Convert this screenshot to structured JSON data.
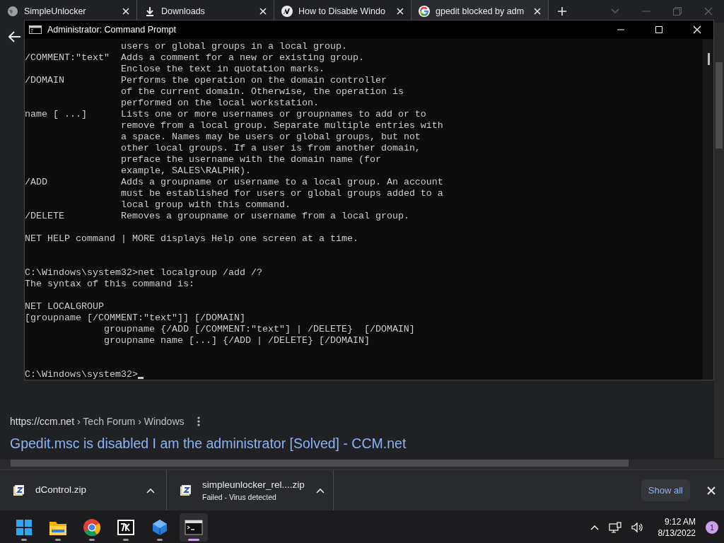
{
  "browser": {
    "tabs": [
      {
        "title": "SimpleUnlocker",
        "selected": false
      },
      {
        "title": "Downloads",
        "selected": false
      },
      {
        "title": "How to Disable Windo",
        "selected": false
      },
      {
        "title": "gpedit blocked by adm",
        "selected": true
      }
    ],
    "result": {
      "site": "https://ccm.net",
      "path": "› Tech Forum › Windows",
      "title": "Gpedit.msc is disabled I am the administrator [Solved] - CCM.net"
    },
    "downloads": [
      {
        "name": "dControl.zip"
      },
      {
        "name": "simpleunlocker_rel....zip",
        "status": "Failed - Virus detected"
      }
    ],
    "show_all": "Show all"
  },
  "console": {
    "title": "Administrator: Command Prompt",
    "lines": [
      {
        "kind": "cont",
        "text": "users or global groups in a local group."
      },
      {
        "kind": "option",
        "option": "/COMMENT:\"text\"",
        "text": "Adds a comment for a new or existing group."
      },
      {
        "kind": "cont",
        "text": "Enclose the text in quotation marks."
      },
      {
        "kind": "option",
        "option": "/DOMAIN",
        "text": "Performs the operation on the domain controller"
      },
      {
        "kind": "cont",
        "text": "of the current domain. Otherwise, the operation is"
      },
      {
        "kind": "cont",
        "text": "performed on the local workstation."
      },
      {
        "kind": "option",
        "option": "name [ ...]",
        "text": "Lists one or more usernames or groupnames to add or to"
      },
      {
        "kind": "cont",
        "text": "remove from a local group. Separate multiple entries with"
      },
      {
        "kind": "cont",
        "text": "a space. Names may be users or global groups, but not"
      },
      {
        "kind": "cont",
        "text": "other local groups. If a user is from another domain,"
      },
      {
        "kind": "cont",
        "text": "preface the username with the domain name (for"
      },
      {
        "kind": "cont",
        "text": "example, SALES\\RALPHR)."
      },
      {
        "kind": "option",
        "option": "/ADD",
        "text": "Adds a groupname or username to a local group. An account"
      },
      {
        "kind": "cont",
        "text": "must be established for users or global groups added to a"
      },
      {
        "kind": "cont",
        "text": "local group with this command."
      },
      {
        "kind": "option",
        "option": "/DELETE",
        "text": "Removes a groupname or username from a local group."
      },
      {
        "kind": "blank"
      },
      {
        "kind": "plain",
        "text": "NET HELP command | MORE displays Help one screen at a time."
      },
      {
        "kind": "blank"
      },
      {
        "kind": "blank"
      },
      {
        "kind": "plain",
        "text": "C:\\Windows\\system32>net localgroup /add /?"
      },
      {
        "kind": "plain",
        "text": "The syntax of this command is:"
      },
      {
        "kind": "blank"
      },
      {
        "kind": "plain",
        "text": "NET LOCALGROUP"
      },
      {
        "kind": "plain",
        "text": "[groupname [/COMMENT:\"text\"]] [/DOMAIN]"
      },
      {
        "kind": "indent",
        "text": "groupname {/ADD [/COMMENT:\"text\"] | /DELETE}  [/DOMAIN]"
      },
      {
        "kind": "indent",
        "text": "groupname name [...] {/ADD | /DELETE} [/DOMAIN]"
      },
      {
        "kind": "blank"
      },
      {
        "kind": "blank"
      },
      {
        "kind": "prompt",
        "text": "C:\\Windows\\system32>"
      }
    ]
  },
  "taskbar": {
    "apps": [
      {
        "active": false
      },
      {
        "active": false
      },
      {
        "active": false
      },
      {
        "active": false
      },
      {
        "active": false
      },
      {
        "active": true
      }
    ],
    "time": "9:12 AM",
    "date": "8/13/2022",
    "notifications": "1"
  }
}
